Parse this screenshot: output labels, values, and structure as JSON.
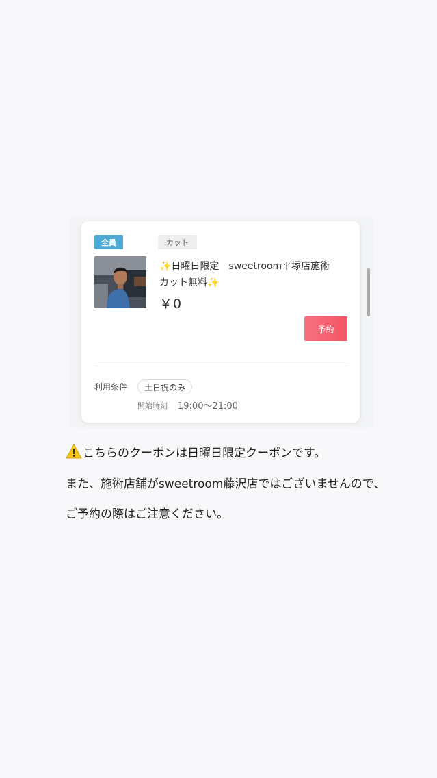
{
  "coupon": {
    "target_badge": "全員",
    "category_badge": "カット",
    "title_line1": "✨日曜日限定　sweetroom平塚店施術",
    "title_line2": "カット無料✨",
    "price": "￥0",
    "reserve_button": "予約",
    "conditions_label": "利用条件",
    "condition_tag": "土日祝のみ",
    "start_time_label": "開始時刻",
    "start_time_value": "19:00〜21:00"
  },
  "notice": {
    "line1": "こちらのクーポンは日曜日限定クーポンです。",
    "line2": "また、施術店舗がsweetroom藤沢店ではございませんので、",
    "line3": "ご予約の際はご注意ください。"
  },
  "colors": {
    "target_badge": "#4ea9d4",
    "reserve_button": "#f55566",
    "warning": "#f5c518"
  }
}
